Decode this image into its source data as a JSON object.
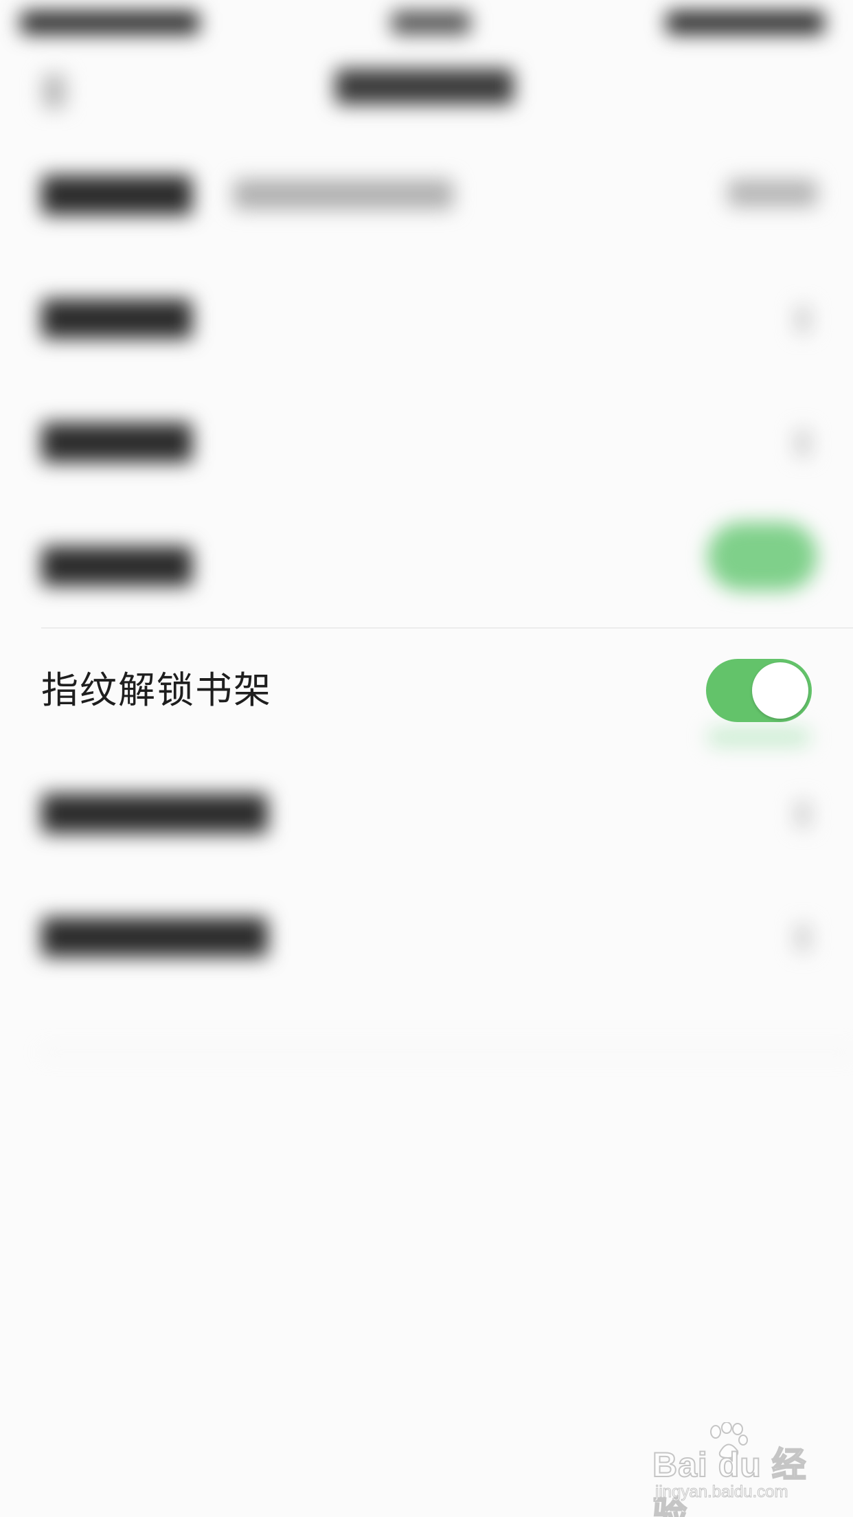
{
  "settings": {
    "fingerprint_row": {
      "label": "指纹解锁书架",
      "toggle_on": true
    }
  },
  "colors": {
    "toggle_on": "#63c36a",
    "background": "#fbfbfb",
    "label_text": "#1e1e1e"
  },
  "icons": {
    "back": "chevron-left-icon",
    "watermark_logo": "baidu-jingyan-logo"
  },
  "watermark": {
    "brand": "Bai du 经验",
    "url": "jingyan.baidu.com"
  }
}
